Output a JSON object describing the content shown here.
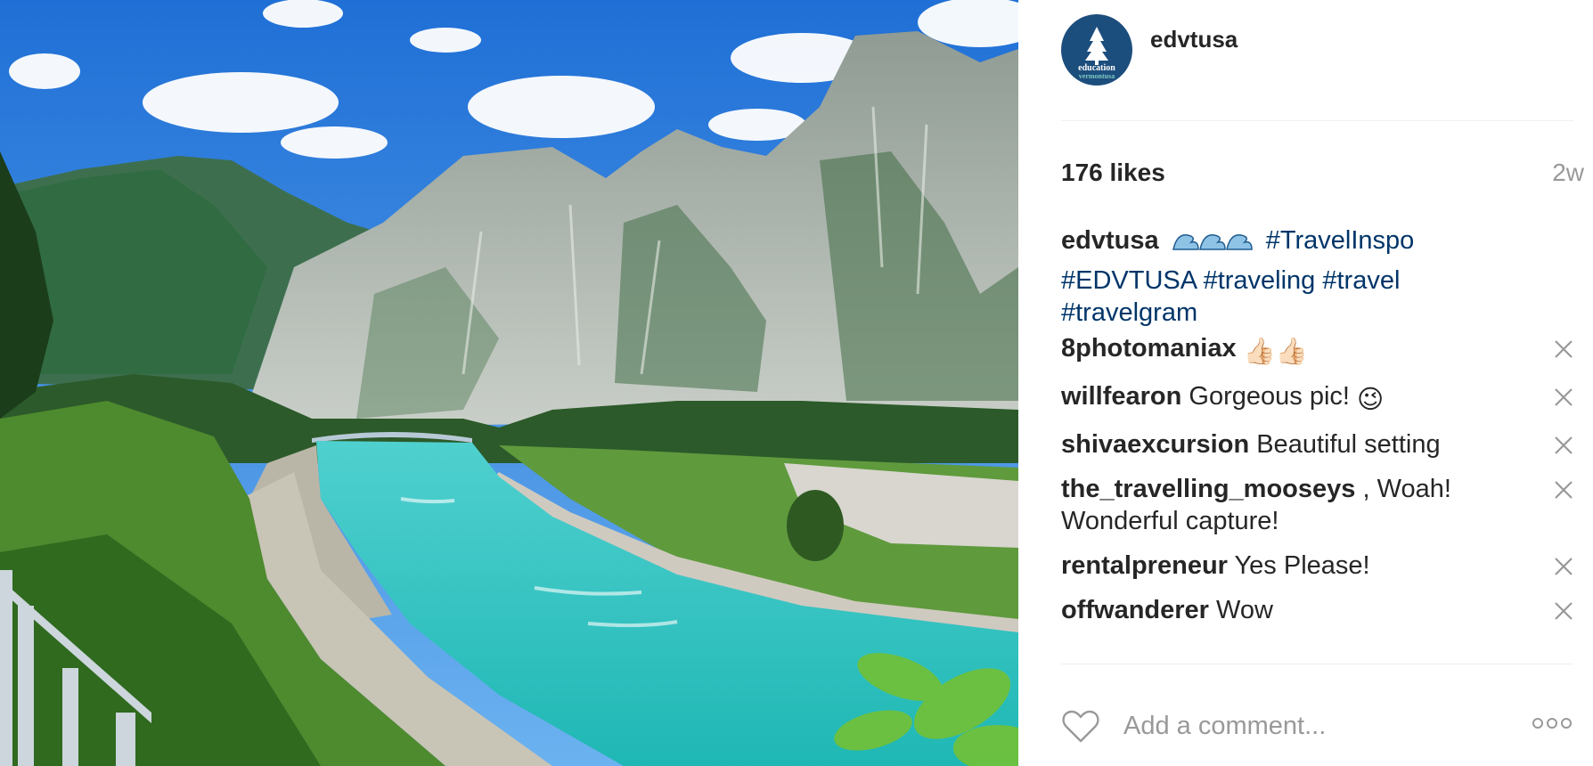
{
  "post": {
    "username": "edvtusa",
    "avatar_text_top": "education",
    "avatar_text_bottom": "vermontusa",
    "likes": "176 likes",
    "age": "2w",
    "caption": {
      "username": "edvtusa",
      "emoji": "🌊🌊🌊",
      "tags": [
        "#TravelInspo",
        "#EDVTUSA",
        "#traveling",
        "#travel",
        "#travelgram"
      ]
    },
    "comments": [
      {
        "username": "8photomaniax",
        "text": "",
        "emoji": "👍🏻👍🏻"
      },
      {
        "username": "willfearon",
        "text": "Gorgeous pic!",
        "emoji": "😉"
      },
      {
        "username": "shivaexcursion",
        "text": "Beautiful setting",
        "emoji": ""
      },
      {
        "username": "the_travelling_mooseys",
        "text": ", Woah! Wonderful capture!",
        "emoji": ""
      },
      {
        "username": "rentalpreneur",
        "text": "Yes Please!",
        "emoji": ""
      },
      {
        "username": "offwanderer",
        "text": "Wow",
        "emoji": ""
      }
    ],
    "add_comment_placeholder": "Add a comment..."
  },
  "icons": {
    "like": "heart-outline-icon",
    "delete_comment": "close-icon",
    "more": "ellipsis-icon"
  },
  "colors": {
    "hashtag": "#003569",
    "muted": "#999999",
    "avatar_bg": "#1c4e7d"
  }
}
